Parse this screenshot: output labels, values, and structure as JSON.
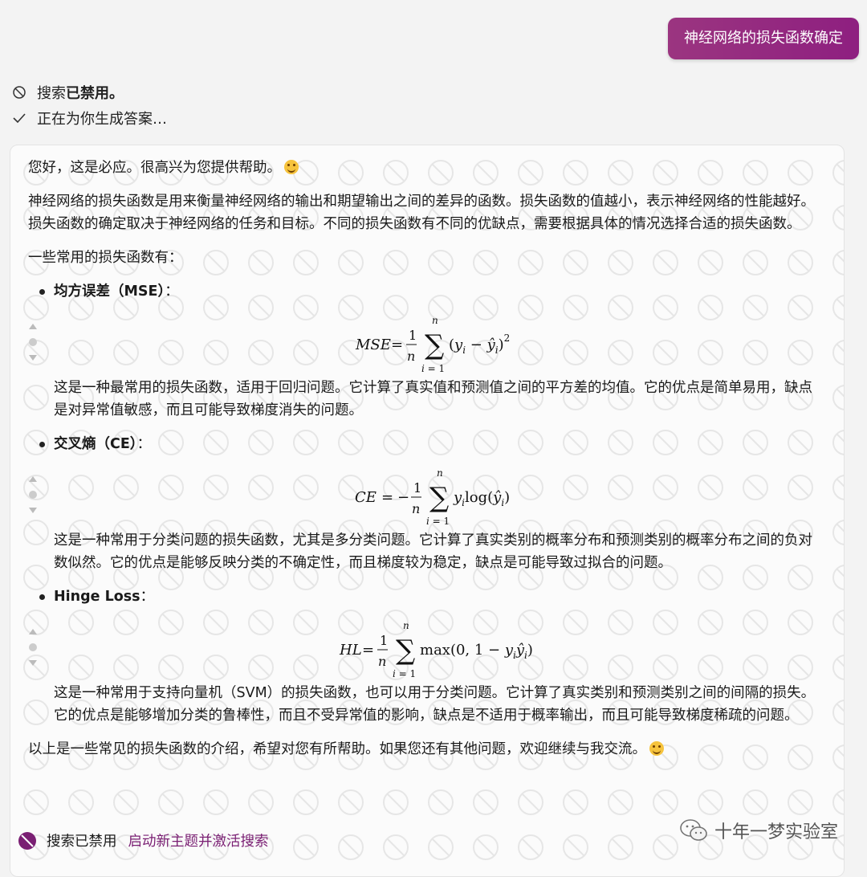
{
  "header": {
    "user_query": "神经网络的损失函数确定"
  },
  "status": [
    {
      "icon": "search-disabled-icon",
      "text_prefix": "搜索",
      "text_bold": "已禁用。"
    },
    {
      "icon": "checkmark-icon",
      "text": "正在为你生成答案…"
    }
  ],
  "answer": {
    "greeting": "您好，这是必应。很高兴为您提供帮助。",
    "intro": "神经网络的损失函数是用来衡量神经网络的输出和期望输出之间的差异的函数。损失函数的值越小，表示神经网络的性能越好。损失函数的确定取决于神经网络的任务和目标。不同的损失函数有不同的优缺点，需要根据具体的情况选择合适的损失函数。",
    "list_intro": "一些常用的损失函数有：",
    "items": [
      {
        "title": "均方误差（MSE）",
        "colon": "：",
        "formula_label": "MSE",
        "description": "这是一种最常用的损失函数，适用于回归问题。它计算了真实值和预测值之间的平方差的均值。它的优点是简单易用，缺点是对异常值敏感，而且可能导致梯度消失的问题。"
      },
      {
        "title": "交叉熵（CE）",
        "colon": "：",
        "formula_label": "CE",
        "description": "这是一种常用于分类问题的损失函数，尤其是多分类问题。它计算了真实类别的概率分布和预测类别的概率分布之间的负对数似然。它的优点是能够反映分类的不确定性，而且梯度较为稳定，缺点是可能导致过拟合的问题。"
      },
      {
        "title": "Hinge Loss",
        "colon": "：",
        "formula_label": "HL",
        "description": "这是一种常用于支持向量机（SVM）的损失函数，也可以用于分类问题。它计算了真实类别和预测类别之间的间隔的损失。它的优点是能够增加分类的鲁棒性，而且不受异常值的影响，缺点是不适用于概率输出，而且可能导致梯度稀疏的问题。"
      }
    ],
    "conclusion": "以上是一些常见的损失函数的介绍，希望对您有所帮助。如果您还有其他问题，欢迎继续与我交流。"
  },
  "footer": {
    "status_text": "搜索已禁用",
    "link_text": "启动新主题并激活搜索"
  },
  "watermark_text": "十年一梦实验室",
  "colors": {
    "accent": "#8e1f80",
    "link": "#7a1f73",
    "background": "#f3f3f3",
    "card": "#fbfbfb"
  }
}
